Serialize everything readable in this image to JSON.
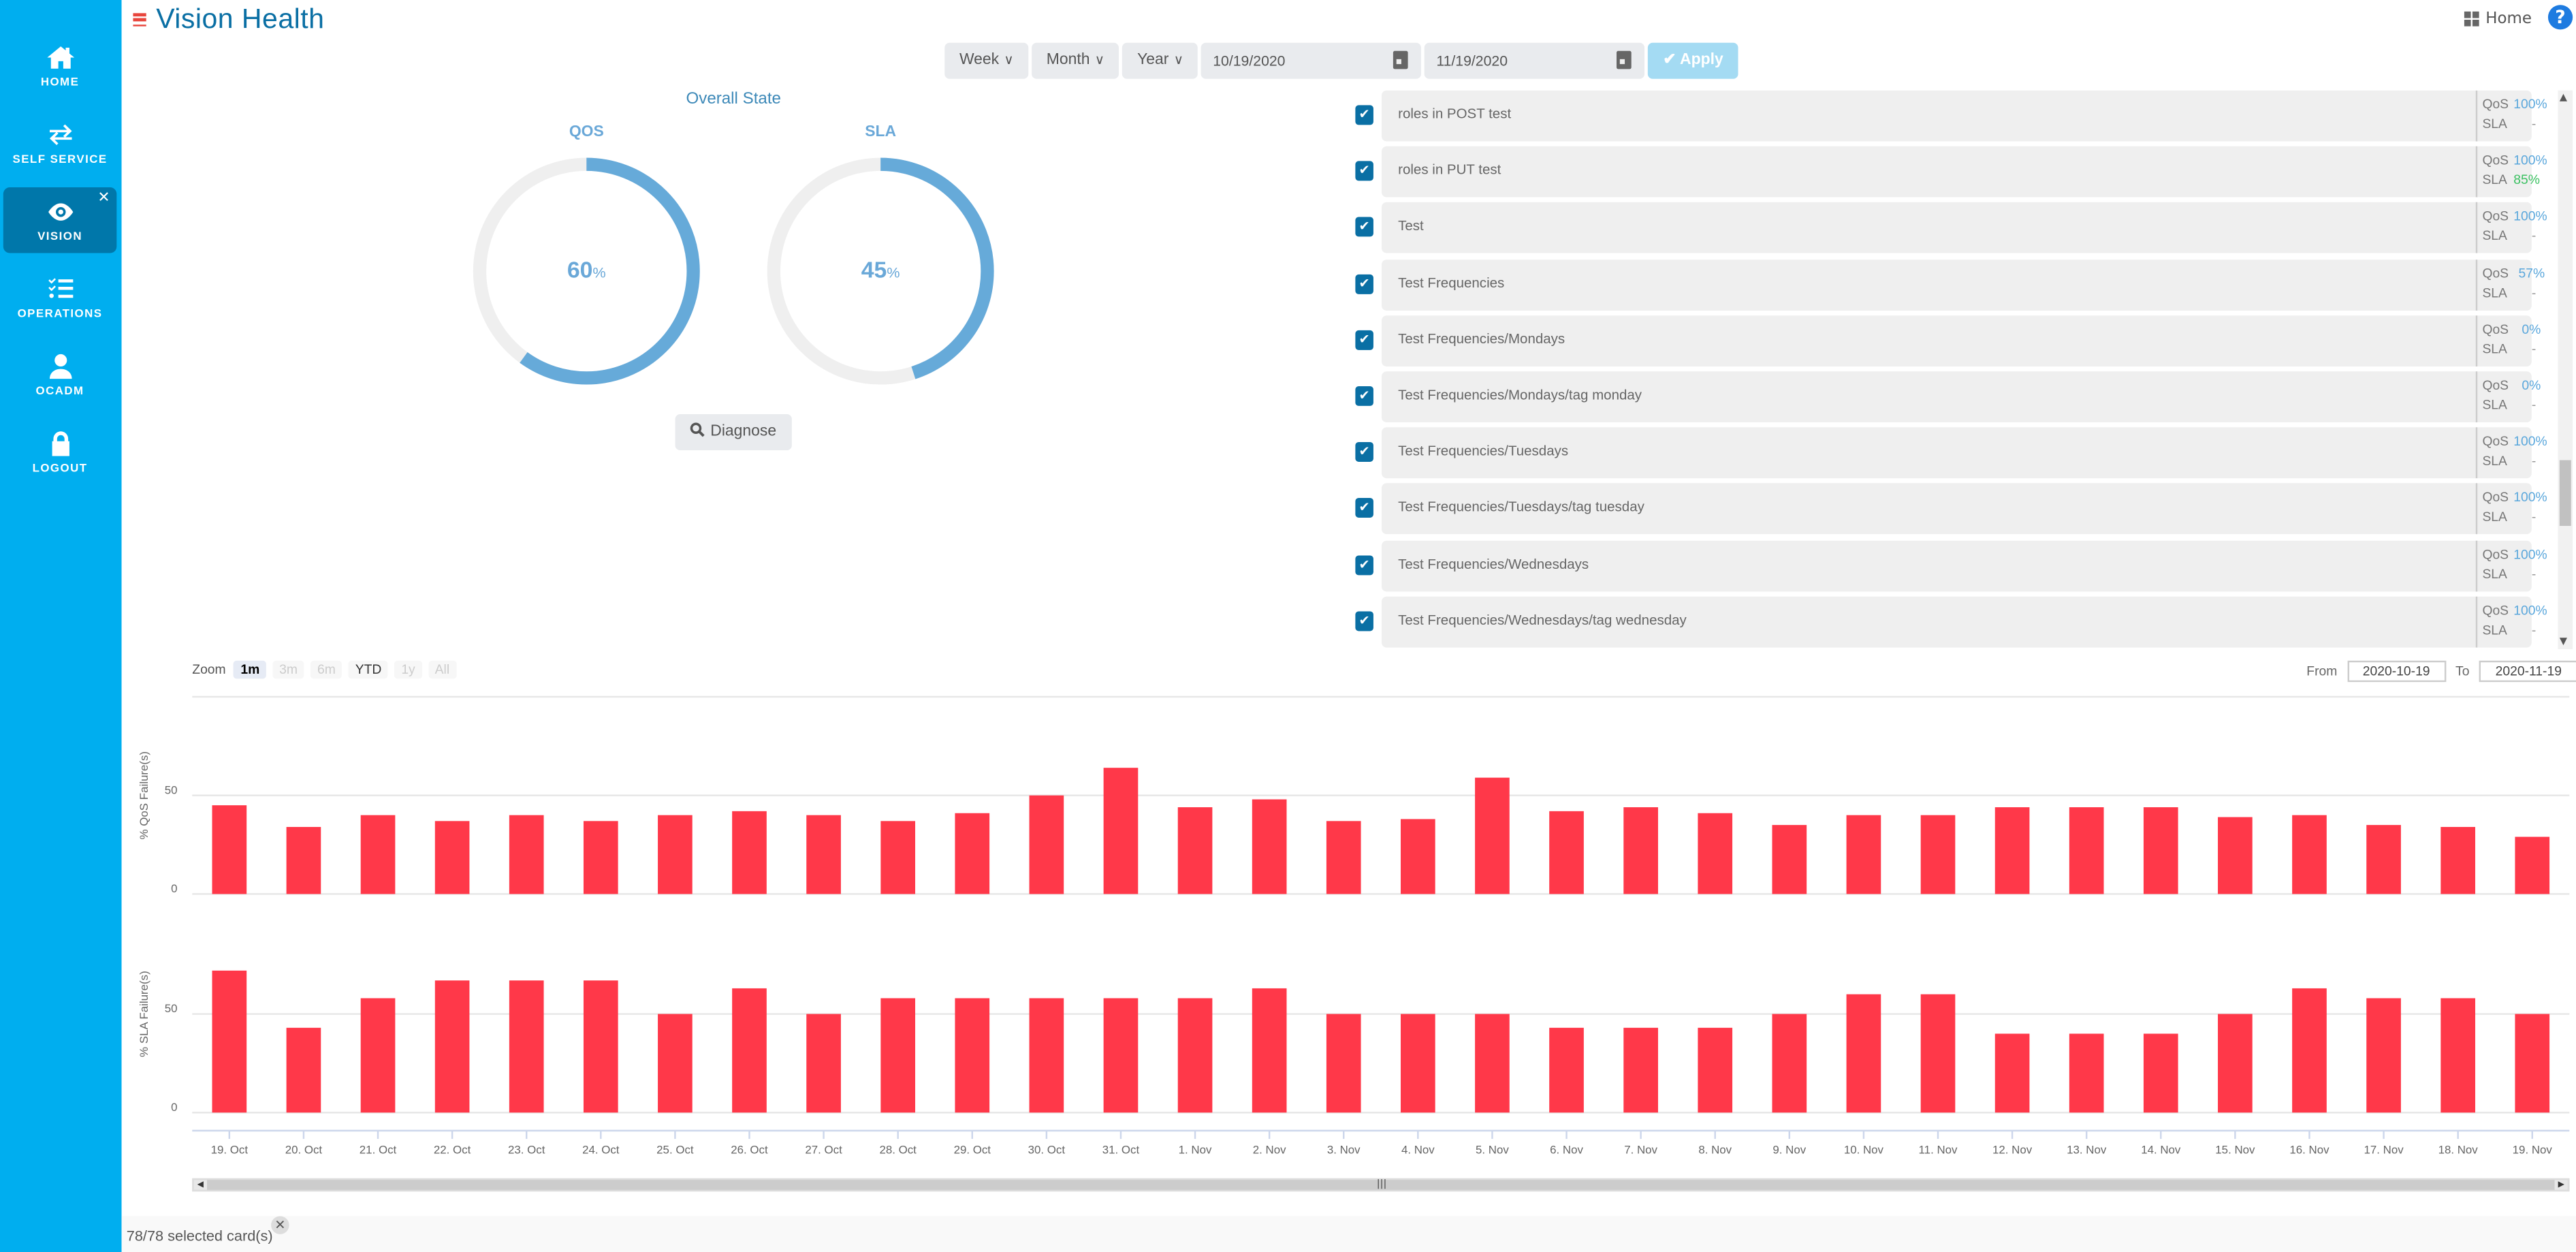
{
  "header": {
    "title": "Vision Health",
    "home_label": "Home",
    "help_label": "?"
  },
  "sidebar": {
    "items": [
      {
        "label": "HOME",
        "icon": "home-icon"
      },
      {
        "label": "SELF SERVICE",
        "icon": "swap-arrows-icon"
      },
      {
        "label": "VISION",
        "icon": "eye-icon",
        "active": true,
        "close": "✕"
      },
      {
        "label": "OPERATIONS",
        "icon": "checklist-icon"
      },
      {
        "label": "OCADM",
        "icon": "user-icon"
      },
      {
        "label": "LOGOUT",
        "icon": "lock-icon"
      }
    ]
  },
  "toolbar": {
    "week_label": "Week",
    "month_label": "Month",
    "year_label": "Year",
    "chevron": "∨",
    "start_date": "10/19/2020",
    "end_date": "11/19/2020",
    "apply_label": "✔ Apply"
  },
  "overall": {
    "title": "Overall State",
    "qos": {
      "label": "QOS",
      "value": 60,
      "display": "60",
      "unit": "%"
    },
    "sla": {
      "label": "SLA",
      "value": 45,
      "display": "45",
      "unit": "%"
    },
    "diagnose_label": "Diagnose",
    "ring_color": "#66aad9",
    "track_color": "#efefef"
  },
  "cards": {
    "items": [
      {
        "name": "roles in POST test",
        "qos": "100%",
        "sla": "-"
      },
      {
        "name": "roles in PUT test",
        "qos": "100%",
        "sla": "85%"
      },
      {
        "name": "Test",
        "qos": "100%",
        "sla": "-"
      },
      {
        "name": "Test Frequencies",
        "qos": "57%",
        "sla": "-"
      },
      {
        "name": "Test Frequencies/Mondays",
        "qos": "0%",
        "sla": "-"
      },
      {
        "name": "Test Frequencies/Mondays/tag monday",
        "qos": "0%",
        "sla": "-"
      },
      {
        "name": "Test Frequencies/Tuesdays",
        "qos": "100%",
        "sla": "-"
      },
      {
        "name": "Test Frequencies/Tuesdays/tag tuesday",
        "qos": "100%",
        "sla": "-"
      },
      {
        "name": "Test Frequencies/Wednesdays",
        "qos": "100%",
        "sla": "-"
      },
      {
        "name": "Test Frequencies/Wednesdays/tag wednesday",
        "qos": "100%",
        "sla": "-"
      }
    ],
    "qos_key": "QoS",
    "sla_key": "SLA",
    "check": "✔"
  },
  "range_selector": {
    "zoom_label": "Zoom",
    "buttons": [
      {
        "label": "1m",
        "state": "active"
      },
      {
        "label": "3m",
        "state": "disabled"
      },
      {
        "label": "6m",
        "state": "disabled"
      },
      {
        "label": "YTD",
        "state": "enabled"
      },
      {
        "label": "1y",
        "state": "disabled"
      },
      {
        "label": "All",
        "state": "disabled"
      }
    ],
    "from_label": "From",
    "from_value": "2020-10-19",
    "to_label": "To",
    "to_value": "2020-11-19"
  },
  "status": {
    "text": "78/78 selected card(s)",
    "close": "✕"
  },
  "chart_data": [
    {
      "type": "bar",
      "title": "",
      "xlabel": "",
      "ylabel": "% QoS Failure(s)",
      "ylim": [
        0,
        70
      ],
      "yticks": [
        0,
        50
      ],
      "grid": true,
      "color": "#ff3849",
      "categories": [
        "19. Oct",
        "20. Oct",
        "21. Oct",
        "22. Oct",
        "23. Oct",
        "24. Oct",
        "25. Oct",
        "26. Oct",
        "27. Oct",
        "28. Oct",
        "29. Oct",
        "30. Oct",
        "31. Oct",
        "1. Nov",
        "2. Nov",
        "3. Nov",
        "4. Nov",
        "5. Nov",
        "6. Nov",
        "7. Nov",
        "8. Nov",
        "9. Nov",
        "10. Nov",
        "11. Nov",
        "12. Nov",
        "13. Nov",
        "14. Nov",
        "15. Nov",
        "16. Nov",
        "17. Nov",
        "18. Nov",
        "19. Nov"
      ],
      "values": [
        45,
        34,
        40,
        37,
        40,
        37,
        40,
        42,
        40,
        37,
        41,
        50,
        64,
        44,
        48,
        37,
        38,
        59,
        42,
        44,
        41,
        35,
        40,
        40,
        44,
        44,
        44,
        39,
        40,
        35,
        34,
        29
      ]
    },
    {
      "type": "bar",
      "title": "",
      "xlabel": "",
      "ylabel": "% SLA Failure(s)",
      "ylim": [
        0,
        75
      ],
      "yticks": [
        0,
        50
      ],
      "grid": true,
      "color": "#ff3849",
      "categories": [
        "19. Oct",
        "20. Oct",
        "21. Oct",
        "22. Oct",
        "23. Oct",
        "24. Oct",
        "25. Oct",
        "26. Oct",
        "27. Oct",
        "28. Oct",
        "29. Oct",
        "30. Oct",
        "31. Oct",
        "1. Nov",
        "2. Nov",
        "3. Nov",
        "4. Nov",
        "5. Nov",
        "6. Nov",
        "7. Nov",
        "8. Nov",
        "9. Nov",
        "10. Nov",
        "11. Nov",
        "12. Nov",
        "13. Nov",
        "14. Nov",
        "15. Nov",
        "16. Nov",
        "17. Nov",
        "18. Nov",
        "19. Nov"
      ],
      "values": [
        72,
        43,
        58,
        67,
        67,
        67,
        50,
        63,
        50,
        58,
        58,
        58,
        58,
        58,
        63,
        50,
        50,
        50,
        43,
        43,
        43,
        50,
        60,
        60,
        40,
        40,
        40,
        50,
        63,
        58,
        58,
        50
      ]
    }
  ]
}
